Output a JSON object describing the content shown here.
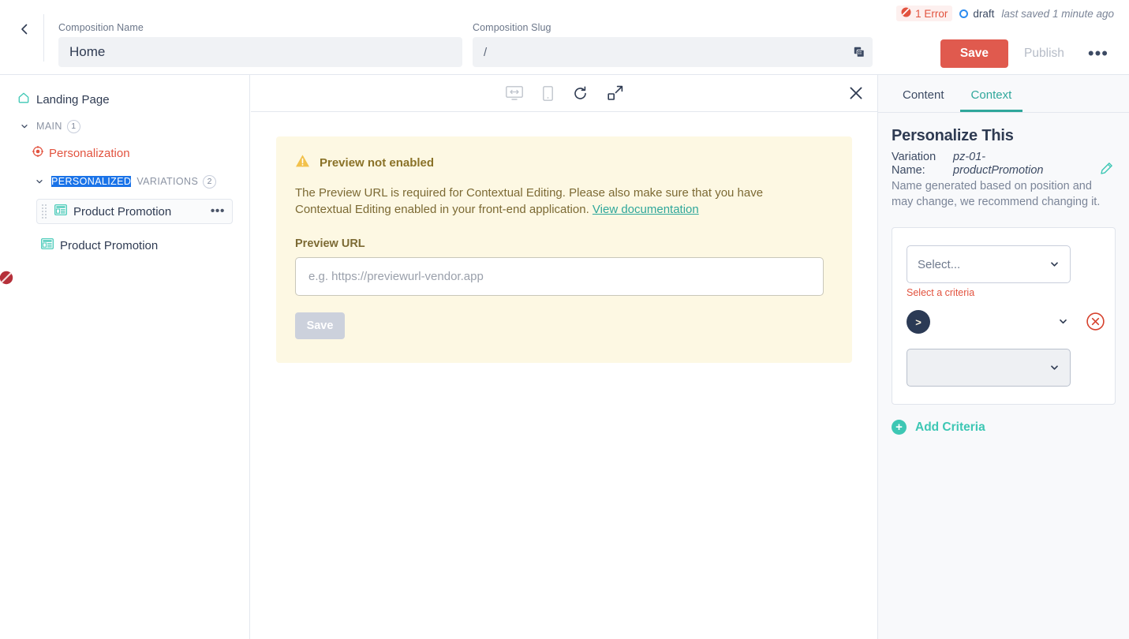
{
  "header": {
    "back_icon": "chevron-left-icon",
    "composition_name_label": "Composition Name",
    "composition_name_value": "Home",
    "composition_slug_label": "Composition Slug",
    "composition_slug_value": "/",
    "copy_icon": "copy-icon",
    "error_badge": "1 Error",
    "error_icon": "error-slash-icon",
    "status": "draft",
    "status_icon": "circle-outline-icon",
    "last_saved": "last saved 1 minute ago",
    "save_label": "Save",
    "publish_label": "Publish",
    "more_label": "•••"
  },
  "sidebar": {
    "root": {
      "label": "Landing Page",
      "icon": "home-icon"
    },
    "main": {
      "label": "MAIN",
      "count": "1",
      "caret": "chevron-down-icon"
    },
    "personalization": {
      "label": "Personalization",
      "icon": "target-icon"
    },
    "variations": {
      "label_highlighted": "PERSONALIZED",
      "label_rest": "VARIATIONS",
      "count": "2",
      "caret": "chevron-down-icon"
    },
    "items": [
      {
        "label": "Product Promotion",
        "icon": "component-icon",
        "menu": "•••",
        "selected": true,
        "has_error": true
      },
      {
        "label": "Product Promotion",
        "icon": "component-icon",
        "selected": false,
        "has_error": false
      }
    ]
  },
  "preview": {
    "toolbar": [
      {
        "name": "desktop-preview-icon",
        "active": false
      },
      {
        "name": "mobile-preview-icon",
        "active": false
      },
      {
        "name": "refresh-icon",
        "active": true
      },
      {
        "name": "open-external-icon",
        "active": true
      }
    ],
    "close_icon": "close-icon",
    "notice": {
      "warning_icon": "warning-triangle-icon",
      "title": "Preview not enabled",
      "body_part1": "The Preview URL is required for Contextual Editing. Please also make sure that you have Contextual Editing enabled in your front-end application. ",
      "link": "View documentation",
      "field_label": "Preview URL",
      "input_placeholder": "e.g. https://previewurl-vendor.app",
      "input_value": "",
      "save_label": "Save"
    }
  },
  "right_panel": {
    "tabs": [
      {
        "label": "Content",
        "active": false
      },
      {
        "label": "Context",
        "active": true
      }
    ],
    "title": "Personalize This",
    "meta": {
      "variation_label": "Variation",
      "name_label": "Name:",
      "variation_value": "pz-01-",
      "name_value": "productPromotion",
      "edit_icon": "pencil-icon",
      "note": "Name generated based on position and may change, we recommend changing it."
    },
    "criteria": {
      "select_placeholder": "Select...",
      "select_chevron": "chevron-down-icon",
      "error_text": "Select a criteria",
      "operator_badge": ">",
      "operator_chevron": "chevron-down-icon",
      "remove_icon": "remove-circle-icon",
      "value_select_placeholder": "",
      "value_chevron": "chevron-down-icon"
    },
    "add_criteria": {
      "label": "Add Criteria",
      "icon": "plus-circle-icon"
    }
  },
  "colors": {
    "accent_teal": "#2fa79b",
    "accent_mint": "#3dc7b4",
    "danger_red": "#e2533f",
    "save_red": "#e05a4e",
    "highlight_blue": "#1a73e8",
    "notice_bg": "#fdf8e3",
    "panel_bg": "#f8f9fb",
    "badge_navy": "#2b3a55"
  }
}
